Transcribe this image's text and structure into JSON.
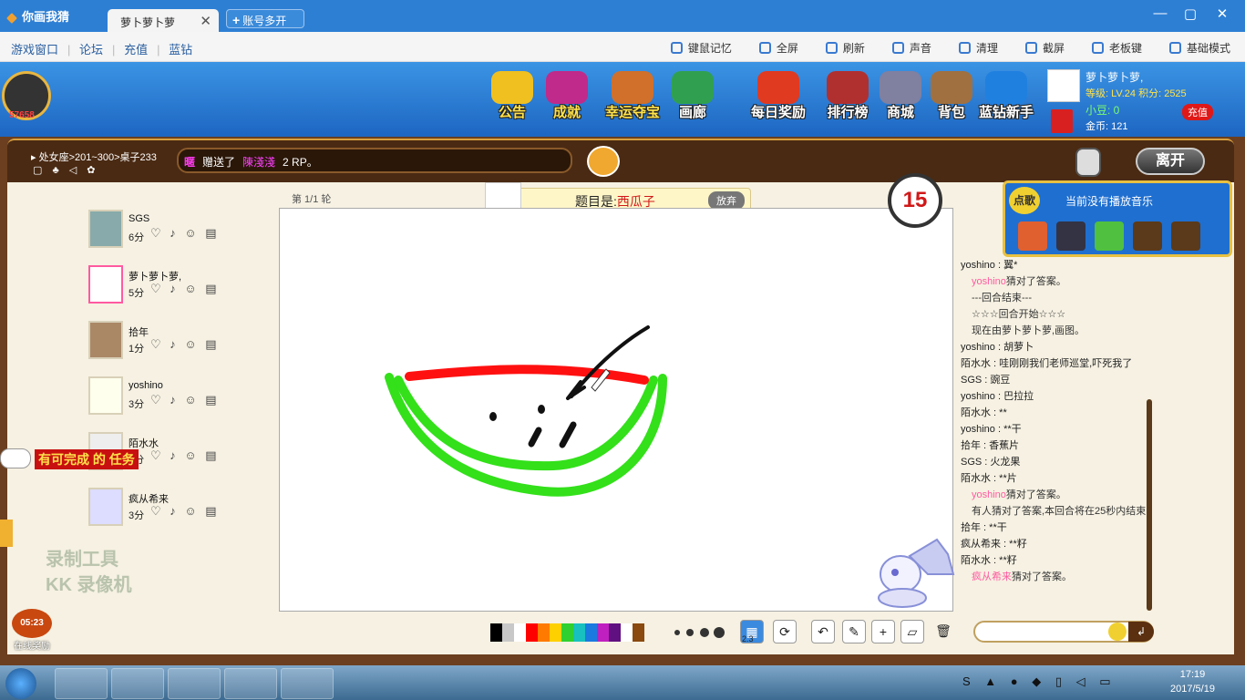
{
  "titlebar": {
    "app_name": "你画我猜",
    "active_tab": "萝卜萝卜萝",
    "close_glyph": "✕",
    "new_tab": "账号多开",
    "win_controls": [
      "—",
      "▢",
      "✕"
    ]
  },
  "menubar": {
    "links": [
      "游戏窗口",
      "论坛",
      "充值",
      "蓝钻"
    ],
    "tools": [
      {
        "label": "键鼠记忆",
        "icon": "mouse-icon"
      },
      {
        "label": "全屏",
        "icon": "fullscreen-icon"
      },
      {
        "label": "刷新",
        "icon": "refresh-icon"
      },
      {
        "label": "声音",
        "icon": "speaker-icon"
      },
      {
        "label": "清理",
        "icon": "trash-icon"
      },
      {
        "label": "截屏",
        "icon": "camera-icon"
      },
      {
        "label": "老板键",
        "icon": "boss-key-icon"
      },
      {
        "label": "基础模式",
        "icon": "mode-icon"
      }
    ]
  },
  "user": {
    "avatar_number": "57658"
  },
  "nav": [
    {
      "label": "公告",
      "icon": "megaphone-icon",
      "color": "#f0c020"
    },
    {
      "label": "成就",
      "icon": "trophy-icon",
      "color": "#c02a8a"
    },
    {
      "label": "幸运夺宝",
      "icon": "treasure-icon",
      "color": "#d0702a"
    },
    {
      "label": "画廊",
      "icon": "gallery-icon",
      "color": "#30a050"
    },
    {
      "label": "每日奖励",
      "icon": "gift-icon",
      "color": "#e03a20"
    },
    {
      "label": "排行榜",
      "icon": "ranking-icon",
      "color": "#b03030"
    },
    {
      "label": "商城",
      "icon": "mall-icon",
      "color": "#8080a0"
    },
    {
      "label": "背包",
      "icon": "backpack-icon",
      "color": "#a07040"
    },
    {
      "label": "蓝钻新手",
      "icon": "blue-diamond-gift-icon",
      "color": "#2080e0"
    }
  ],
  "profile": {
    "name": "萝卜萝卜萝,",
    "level_text": "等级: LV.24  积分: 2525",
    "beans_text": "小豆: 0",
    "coins_text": "金币: 121",
    "recharge": "充值"
  },
  "room": {
    "breadcrumb": "处女座>201~300>桌子233",
    "gift_message": {
      "tag": "暱",
      "text1": "赠送了",
      "who": "陳淺淺",
      "text2": "2 RP。"
    },
    "leave": "离开"
  },
  "players": [
    {
      "name": "SGS",
      "score": "6分"
    },
    {
      "name": "萝卜萝卜萝,",
      "score": "5分"
    },
    {
      "name": "拾年",
      "score": "1分"
    },
    {
      "name": "yoshino",
      "score": "3分"
    },
    {
      "name": "陌水水",
      "score": "3分"
    },
    {
      "name": "疯从希来",
      "score": "3分"
    }
  ],
  "player_icons": "♡ ♪ ☺ ▤",
  "task": "有可完成 的 任务",
  "recorder": [
    "录制工具",
    "KK 录像机"
  ],
  "online": {
    "time": "05:23",
    "label": "在线奖励"
  },
  "game": {
    "round": "第 1/1 轮",
    "topic_prefix": "题目是:",
    "topic_answer": "西瓜子",
    "give_up": "放弃",
    "timer": "15"
  },
  "palette": [
    "#000000",
    "#c8c8c8",
    "#ffffff",
    "#ff0000",
    "#ff7a00",
    "#ffd000",
    "#30d030",
    "#18c0c0",
    "#1a7ae0",
    "#c020c0",
    "#601080",
    "#ffffff",
    "#8a4a10"
  ],
  "tool_buttons": [
    {
      "name": "fill-icon",
      "glyph": "▦"
    },
    {
      "name": "rotate-icon",
      "glyph": "⟳"
    },
    {
      "name": "undo-icon",
      "glyph": "↶"
    },
    {
      "name": "pen-icon",
      "glyph": "✎"
    },
    {
      "name": "add-icon",
      "glyph": "+"
    },
    {
      "name": "eraser-icon",
      "glyph": "▱"
    },
    {
      "name": "trash-icon",
      "glyph": "🗑"
    }
  ],
  "fill_count": "2.3",
  "music": {
    "tag": "点歌",
    "now_playing": "当前没有播放音乐"
  },
  "chat": [
    {
      "who": "yoshino",
      "text": " : 翼*",
      "sys": false
    },
    {
      "who": "yoshino",
      "text": "猜对了答案。",
      "sys": true,
      "hl": true
    },
    {
      "who": "",
      "text": "---回合结束---",
      "sys": true
    },
    {
      "who": "",
      "text": "☆☆☆回合开始☆☆☆",
      "sys": true
    },
    {
      "who": "",
      "text": "现在由萝卜萝卜萝,画图。",
      "sys": true
    },
    {
      "who": "yoshino",
      "text": " : 胡萝卜",
      "sys": false
    },
    {
      "who": "陌水水",
      "text": " : 哇刚刚我们老师巡堂,吓死我了",
      "sys": false
    },
    {
      "who": "SGS",
      "text": " : 豌豆",
      "sys": false
    },
    {
      "who": "yoshino",
      "text": " : 巴拉拉",
      "sys": false
    },
    {
      "who": "陌水水",
      "text": " : **",
      "sys": false
    },
    {
      "who": "yoshino",
      "text": " : **干",
      "sys": false
    },
    {
      "who": "拾年",
      "text": " : 香蕉片",
      "sys": false
    },
    {
      "who": "SGS",
      "text": " : 火龙果",
      "sys": false
    },
    {
      "who": "陌水水",
      "text": " : **片",
      "sys": false
    },
    {
      "who": "yoshino",
      "text": "猜对了答案。",
      "sys": true,
      "hl": true
    },
    {
      "who": "",
      "text": "有人猜对了答案,本回合将在25秒内结束",
      "sys": true
    },
    {
      "who": "拾年",
      "text": " : **干",
      "sys": false
    },
    {
      "who": "疯从希来",
      "text": " : **籽",
      "sys": false
    },
    {
      "who": "陌水水",
      "text": " : **籽",
      "sys": false
    },
    {
      "who": "疯从希来",
      "text": "猜对了答案。",
      "sys": true,
      "hl": true
    }
  ],
  "taskbar": {
    "clock_time": "17:19",
    "clock_date": "2017/5/19"
  }
}
